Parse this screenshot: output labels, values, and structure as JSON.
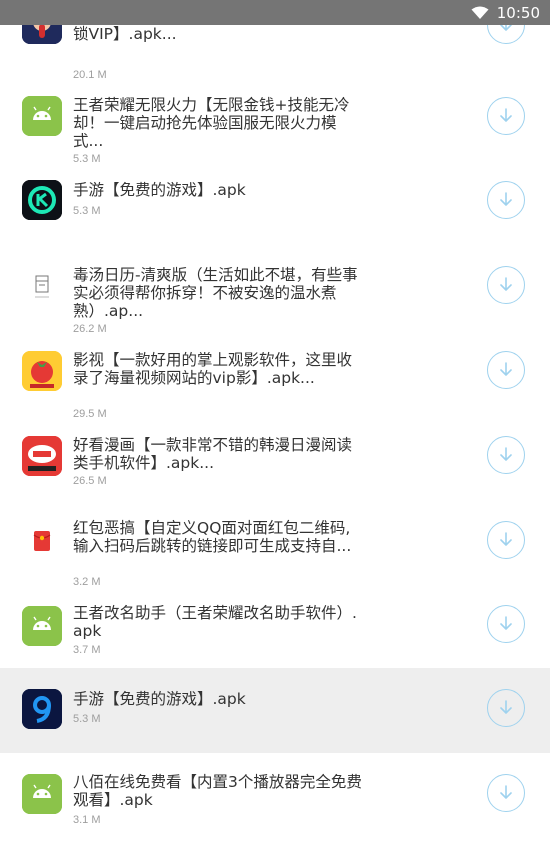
{
  "status": {
    "time": "10:50",
    "wifi_icon": "wifi-icon"
  },
  "items": [
    {
      "icon": "voice-app-icon",
      "title": "…变声器【…超多功能的变声软件！已解锁VIP】.apk...",
      "size": "20.1 M"
    },
    {
      "icon": "android-icon",
      "title": "王者荣耀无限火力【无限金钱+技能无冷却！一键启动抢先体验国服无限火力模式...",
      "size": "5.3 M"
    },
    {
      "icon": "game-k-icon",
      "title": "手游【免费的游戏】.apk",
      "size": "5.3 M"
    },
    {
      "icon": "calendar-icon",
      "title": "毒汤日历-清爽版（生活如此不堪，有些事实必须得帮你拆穿！不被安逸的温水煮熟）.ap...",
      "size": "26.2 M"
    },
    {
      "icon": "tomato-icon",
      "title": "影视【一款好用的掌上观影软件，这里收录了海量视频网站的vip影】.apk...",
      "size": "29.5 M"
    },
    {
      "icon": "comic-icon",
      "title": "好看漫画【一款非常不错的韩漫日漫阅读类手机软件】.apk...",
      "size": "26.5 M"
    },
    {
      "icon": "red-envelope-icon",
      "title": "红包恶搞【自定义QQ面对面红包二维码,输入扫码后跳转的链接即可生成支持自...",
      "size": "3.2 M"
    },
    {
      "icon": "android-icon",
      "title": "王者改名助手（王者荣耀改名助手软件）.apk",
      "size": "3.7 M"
    },
    {
      "icon": "game-9-icon",
      "title": "手游【免费的游戏】.apk",
      "size": "5.3 M"
    },
    {
      "icon": "android-icon",
      "title": "八佰在线免费看【内置3个播放器完全免费观看】.apk",
      "size": "3.1 M"
    }
  ],
  "colors": {
    "accent": "#9fd2ee",
    "android_green": "#8bc34a",
    "highlight": "#eeeeee",
    "status_bar": "#757575"
  }
}
